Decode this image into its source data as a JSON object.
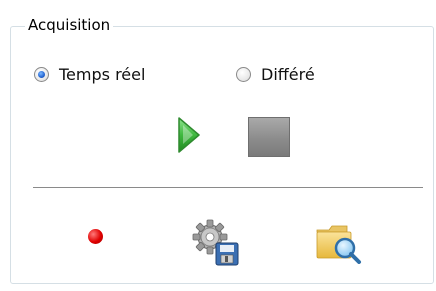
{
  "acquisition": {
    "title": "Acquisition",
    "mode": {
      "options": [
        {
          "label": "Temps réel",
          "selected": true
        },
        {
          "label": "Différé",
          "selected": false
        }
      ]
    },
    "controls": {
      "play_icon": "play-icon",
      "stop_icon": "stop-icon"
    },
    "tools": {
      "record_icon": "record-icon",
      "settings_icon": "gear-save-icon",
      "folder_icon": "folder-search-icon"
    },
    "colors": {
      "radio_selected": "#2a6bd6",
      "play_green": "#3fb83f",
      "record_red": "#e00000",
      "folder_yellow": "#f2c94c"
    }
  }
}
